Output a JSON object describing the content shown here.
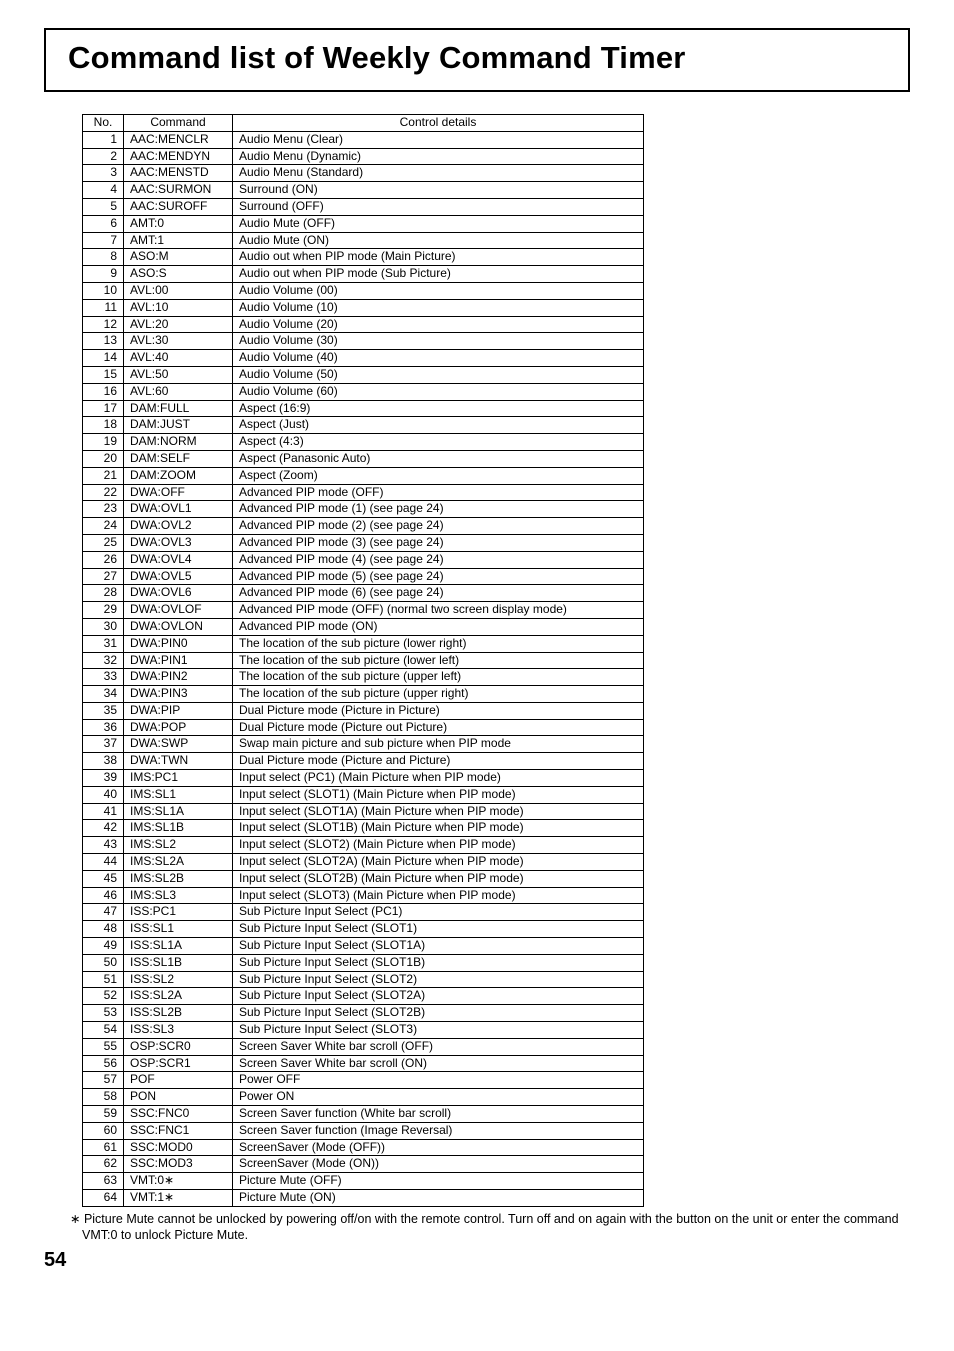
{
  "title": "Command list of Weekly Command Timer",
  "headers": {
    "no": "No.",
    "command": "Command",
    "details": "Control details"
  },
  "rows": [
    {
      "no": "1",
      "cmd": "AAC:MENCLR",
      "det": "Audio Menu (Clear)"
    },
    {
      "no": "2",
      "cmd": "AAC:MENDYN",
      "det": "Audio Menu (Dynamic)"
    },
    {
      "no": "3",
      "cmd": "AAC:MENSTD",
      "det": "Audio Menu (Standard)"
    },
    {
      "no": "4",
      "cmd": "AAC:SURMON",
      "det": "Surround (ON)"
    },
    {
      "no": "5",
      "cmd": "AAC:SUROFF",
      "det": "Surround (OFF)"
    },
    {
      "no": "6",
      "cmd": "AMT:0",
      "det": "Audio Mute (OFF)"
    },
    {
      "no": "7",
      "cmd": "AMT:1",
      "det": "Audio Mute (ON)"
    },
    {
      "no": "8",
      "cmd": "ASO:M",
      "det": "Audio out when PIP mode (Main Picture)"
    },
    {
      "no": "9",
      "cmd": "ASO:S",
      "det": "Audio out when PIP mode (Sub Picture)"
    },
    {
      "no": "10",
      "cmd": "AVL:00",
      "det": "Audio Volume (00)"
    },
    {
      "no": "11",
      "cmd": "AVL:10",
      "det": "Audio Volume (10)"
    },
    {
      "no": "12",
      "cmd": "AVL:20",
      "det": "Audio Volume (20)"
    },
    {
      "no": "13",
      "cmd": "AVL:30",
      "det": "Audio Volume (30)"
    },
    {
      "no": "14",
      "cmd": "AVL:40",
      "det": "Audio Volume (40)"
    },
    {
      "no": "15",
      "cmd": "AVL:50",
      "det": "Audio Volume (50)"
    },
    {
      "no": "16",
      "cmd": "AVL:60",
      "det": "Audio Volume (60)"
    },
    {
      "no": "17",
      "cmd": "DAM:FULL",
      "det": "Aspect (16:9)"
    },
    {
      "no": "18",
      "cmd": "DAM:JUST",
      "det": "Aspect (Just)"
    },
    {
      "no": "19",
      "cmd": "DAM:NORM",
      "det": "Aspect (4:3)"
    },
    {
      "no": "20",
      "cmd": "DAM:SELF",
      "det": "Aspect (Panasonic Auto)"
    },
    {
      "no": "21",
      "cmd": "DAM:ZOOM",
      "det": "Aspect (Zoom)"
    },
    {
      "no": "22",
      "cmd": "DWA:OFF",
      "det": "Advanced PIP mode (OFF)"
    },
    {
      "no": "23",
      "cmd": "DWA:OVL1",
      "det": "Advanced PIP mode (1) (see page 24)"
    },
    {
      "no": "24",
      "cmd": "DWA:OVL2",
      "det": "Advanced PIP mode (2) (see page 24)"
    },
    {
      "no": "25",
      "cmd": "DWA:OVL3",
      "det": "Advanced PIP mode (3) (see page 24)"
    },
    {
      "no": "26",
      "cmd": "DWA:OVL4",
      "det": "Advanced PIP mode (4) (see page 24)"
    },
    {
      "no": "27",
      "cmd": "DWA:OVL5",
      "det": "Advanced PIP mode (5) (see page 24)"
    },
    {
      "no": "28",
      "cmd": "DWA:OVL6",
      "det": "Advanced PIP mode (6) (see page 24)"
    },
    {
      "no": "29",
      "cmd": "DWA:OVLOF",
      "det": "Advanced PIP mode (OFF) (normal two screen display mode)"
    },
    {
      "no": "30",
      "cmd": "DWA:OVLON",
      "det": "Advanced PIP mode (ON)"
    },
    {
      "no": "31",
      "cmd": "DWA:PIN0",
      "det": "The location of the sub picture (lower right)"
    },
    {
      "no": "32",
      "cmd": "DWA:PIN1",
      "det": "The location of the sub picture (lower left)"
    },
    {
      "no": "33",
      "cmd": "DWA:PIN2",
      "det": "The location of the sub picture (upper left)"
    },
    {
      "no": "34",
      "cmd": "DWA:PIN3",
      "det": "The location of the sub picture (upper right)"
    },
    {
      "no": "35",
      "cmd": "DWA:PIP",
      "det": "Dual Picture mode (Picture in Picture)"
    },
    {
      "no": "36",
      "cmd": "DWA:POP",
      "det": "Dual Picture mode (Picture out Picture)"
    },
    {
      "no": "37",
      "cmd": "DWA:SWP",
      "det": "Swap main picture and sub picture when PIP mode"
    },
    {
      "no": "38",
      "cmd": "DWA:TWN",
      "det": "Dual Picture mode (Picture and Picture)"
    },
    {
      "no": "39",
      "cmd": "IMS:PC1",
      "det": "Input select (PC1) (Main Picture when PIP mode)"
    },
    {
      "no": "40",
      "cmd": "IMS:SL1",
      "det": "Input select (SLOT1) (Main Picture when PIP mode)"
    },
    {
      "no": "41",
      "cmd": "IMS:SL1A",
      "det": "Input select (SLOT1A) (Main Picture when PIP mode)"
    },
    {
      "no": "42",
      "cmd": "IMS:SL1B",
      "det": "Input select (SLOT1B) (Main Picture when PIP mode)"
    },
    {
      "no": "43",
      "cmd": "IMS:SL2",
      "det": "Input select (SLOT2) (Main Picture when PIP mode)"
    },
    {
      "no": "44",
      "cmd": "IMS:SL2A",
      "det": "Input select (SLOT2A) (Main Picture when PIP mode)"
    },
    {
      "no": "45",
      "cmd": "IMS:SL2B",
      "det": "Input select (SLOT2B) (Main Picture when PIP mode)"
    },
    {
      "no": "46",
      "cmd": "IMS:SL3",
      "det": "Input select (SLOT3) (Main Picture when PIP mode)"
    },
    {
      "no": "47",
      "cmd": "ISS:PC1",
      "det": "Sub Picture Input Select (PC1)"
    },
    {
      "no": "48",
      "cmd": "ISS:SL1",
      "det": "Sub Picture Input Select (SLOT1)"
    },
    {
      "no": "49",
      "cmd": "ISS:SL1A",
      "det": "Sub Picture Input Select (SLOT1A)"
    },
    {
      "no": "50",
      "cmd": "ISS:SL1B",
      "det": "Sub Picture Input Select (SLOT1B)"
    },
    {
      "no": "51",
      "cmd": "ISS:SL2",
      "det": "Sub Picture Input Select (SLOT2)"
    },
    {
      "no": "52",
      "cmd": "ISS:SL2A",
      "det": "Sub Picture Input Select (SLOT2A)"
    },
    {
      "no": "53",
      "cmd": "ISS:SL2B",
      "det": "Sub Picture Input Select (SLOT2B)"
    },
    {
      "no": "54",
      "cmd": "ISS:SL3",
      "det": "Sub Picture Input Select (SLOT3)"
    },
    {
      "no": "55",
      "cmd": "OSP:SCR0",
      "det": "Screen Saver White bar scroll (OFF)"
    },
    {
      "no": "56",
      "cmd": "OSP:SCR1",
      "det": "Screen Saver White bar scroll (ON)"
    },
    {
      "no": "57",
      "cmd": "POF",
      "det": "Power OFF"
    },
    {
      "no": "58",
      "cmd": "PON",
      "det": "Power ON"
    },
    {
      "no": "59",
      "cmd": "SSC:FNC0",
      "det": "Screen Saver function (White bar scroll)"
    },
    {
      "no": "60",
      "cmd": "SSC:FNC1",
      "det": "Screen Saver function (Image Reversal)"
    },
    {
      "no": "61",
      "cmd": "SSC:MOD0",
      "det": "ScreenSaver (Mode (OFF))"
    },
    {
      "no": "62",
      "cmd": "SSC:MOD3",
      "det": "ScreenSaver (Mode (ON))"
    },
    {
      "no": "63",
      "cmd": "VMT:0∗",
      "det": "Picture Mute (OFF)"
    },
    {
      "no": "64",
      "cmd": "VMT:1∗",
      "det": "Picture Mute (ON)"
    }
  ],
  "footnote": "∗ Picture Mute cannot be unlocked by powering off/on with the remote control. Turn off and on again with the button on the unit or enter the command VMT:0 to unlock Picture Mute.",
  "pagenum": "54"
}
